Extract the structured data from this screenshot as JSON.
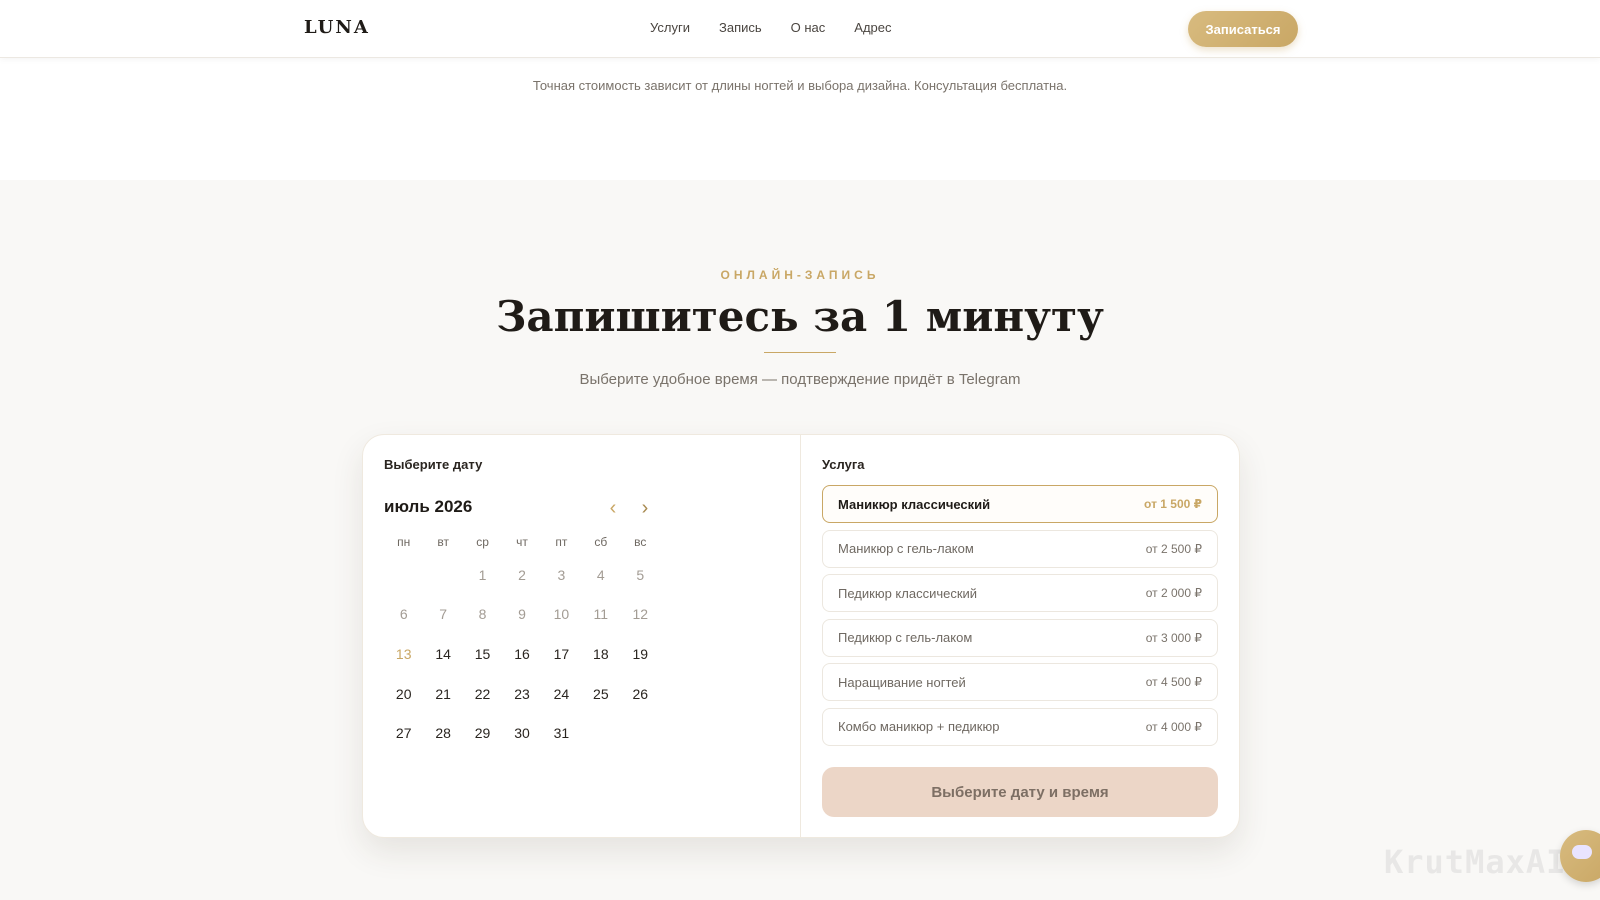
{
  "header": {
    "logo": "LUNA",
    "nav": [
      "Услуги",
      "Запись",
      "О нас",
      "Адрес"
    ],
    "cta": "Записаться"
  },
  "top_note": "Точная стоимость зависит от длины ногтей и выбора дизайна. Консультация бесплатна.",
  "booking": {
    "eyebrow": "ОНЛАЙН-ЗАПИСЬ",
    "title": "Запишитесь за 1 минуту",
    "subtitle": "Выберите удобное время — подтверждение придёт в Telegram",
    "calendar": {
      "label": "Выберите дату",
      "month": "июль 2026",
      "weekdays": [
        "пн",
        "вт",
        "ср",
        "чт",
        "пт",
        "сб",
        "вс"
      ],
      "rows": [
        [
          "",
          "",
          "1",
          "2",
          "3",
          "4",
          "5"
        ],
        [
          "6",
          "7",
          "8",
          "9",
          "10",
          "11",
          "12"
        ],
        [
          "13",
          "14",
          "15",
          "16",
          "17",
          "18",
          "19"
        ],
        [
          "20",
          "21",
          "22",
          "23",
          "24",
          "25",
          "26"
        ],
        [
          "27",
          "28",
          "29",
          "30",
          "31",
          "",
          ""
        ]
      ],
      "today": "13"
    },
    "services": {
      "label": "Услуга",
      "items": [
        {
          "name": "Маникюр классический",
          "price": "от 1 500 ₽"
        },
        {
          "name": "Маникюр с гель-лаком",
          "price": "от 2 500 ₽"
        },
        {
          "name": "Педикюр классический",
          "price": "от 2 000 ₽"
        },
        {
          "name": "Педикюр с гель-лаком",
          "price": "от 3 000 ₽"
        },
        {
          "name": "Наращивание ногтей",
          "price": "от 4 500 ₽"
        },
        {
          "name": "Комбо маникюр + педикюр",
          "price": "от 4 000 ₽"
        }
      ],
      "selected_index": 0
    },
    "submit": "Выберите дату и время"
  },
  "watermark": "KrutMaxAI",
  "colors": {
    "accent": "#c9a765",
    "background": "#f9f8f6"
  }
}
